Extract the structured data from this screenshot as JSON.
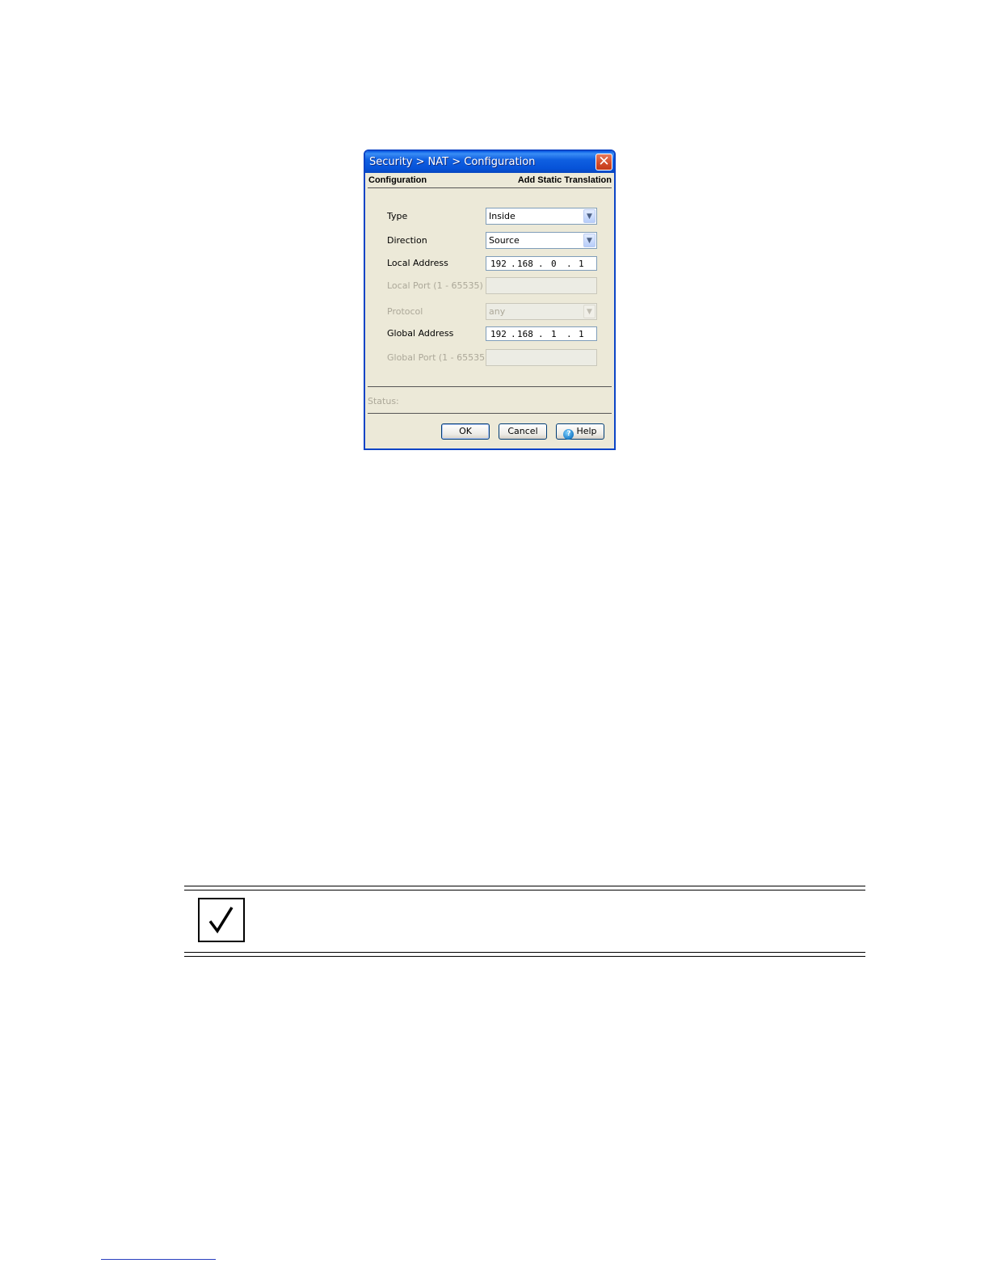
{
  "dialog": {
    "title": "Security > NAT > Configuration",
    "close_glyph": "✕",
    "section_left": "Configuration",
    "section_right": "Add Static Translation",
    "fields": {
      "type": {
        "label": "Type",
        "value": "Inside"
      },
      "direction": {
        "label": "Direction",
        "value": "Source"
      },
      "local_address": {
        "label": "Local Address",
        "octets": [
          "192",
          "168",
          "0",
          "1"
        ]
      },
      "local_port": {
        "label": "Local Port (1 - 65535)",
        "value": ""
      },
      "protocol": {
        "label": "Protocol",
        "value": "any"
      },
      "global_address": {
        "label": "Global Address",
        "octets": [
          "192",
          "168",
          "1",
          "1"
        ]
      },
      "global_port": {
        "label": "Global Port (1 - 65535)",
        "value": ""
      }
    },
    "status_label": "Status:",
    "buttons": {
      "ok": "OK",
      "cancel": "Cancel",
      "help": "Help",
      "help_glyph": "?"
    }
  },
  "note": {
    "icon": "checkmark-icon"
  },
  "colors": {
    "title_bar": "#0653d8",
    "dialog_bg": "#ece9d8",
    "close_button": "#d24a28"
  }
}
